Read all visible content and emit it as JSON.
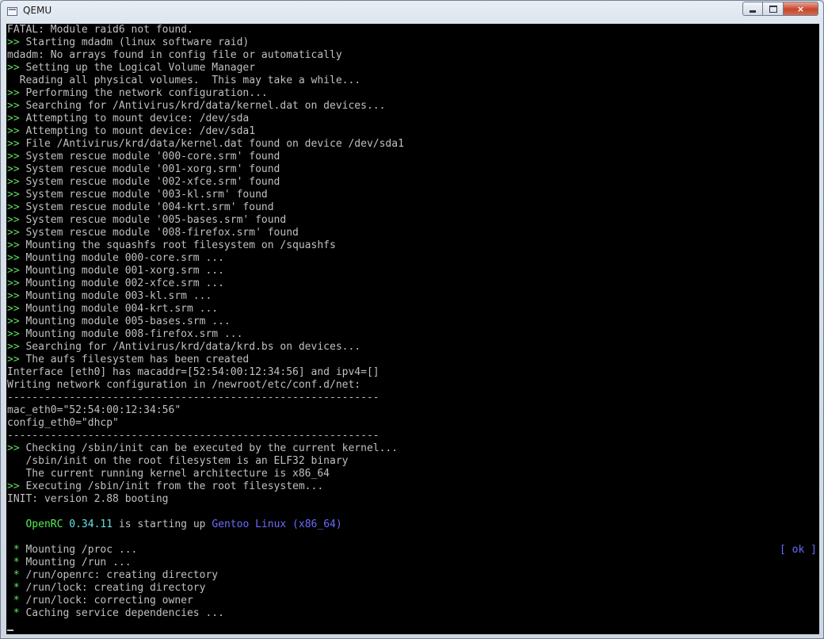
{
  "window": {
    "title": "QEMU",
    "icon": "qemu-window-icon",
    "minimize_icon": "minimize-icon",
    "maximize_icon": "maximize-icon",
    "close_icon": "close-icon",
    "close_label": "×"
  },
  "colors": {
    "terminal_bg": "#000000",
    "text": "#c0c0c0",
    "prompt_green": "#55ee55",
    "cyan": "#66e0e0",
    "blue": "#6b6bff"
  },
  "terminal": {
    "lines": [
      {
        "text": "FATAL: Module raid6 not found."
      },
      {
        "prefix": ">>",
        "text": " Starting mdadm (linux software raid)"
      },
      {
        "text": "mdadm: No arrays found in config file or automatically"
      },
      {
        "prefix": ">>",
        "text": " Setting up the Logical Volume Manager"
      },
      {
        "text": "  Reading all physical volumes.  This may take a while..."
      },
      {
        "prefix": ">>",
        "text": " Performing the network configuration..."
      },
      {
        "prefix": ">>",
        "text": " Searching for /Antivirus/krd/data/kernel.dat on devices..."
      },
      {
        "prefix": ">>",
        "text": " Attempting to mount device: /dev/sda"
      },
      {
        "prefix": ">>",
        "text": " Attempting to mount device: /dev/sda1"
      },
      {
        "prefix": ">>",
        "text": " File /Antivirus/krd/data/kernel.dat found on device /dev/sda1"
      },
      {
        "prefix": ">>",
        "text": " System rescue module '000-core.srm' found"
      },
      {
        "prefix": ">>",
        "text": " System rescue module '001-xorg.srm' found"
      },
      {
        "prefix": ">>",
        "text": " System rescue module '002-xfce.srm' found"
      },
      {
        "prefix": ">>",
        "text": " System rescue module '003-kl.srm' found"
      },
      {
        "prefix": ">>",
        "text": " System rescue module '004-krt.srm' found"
      },
      {
        "prefix": ">>",
        "text": " System rescue module '005-bases.srm' found"
      },
      {
        "prefix": ">>",
        "text": " System rescue module '008-firefox.srm' found"
      },
      {
        "prefix": ">>",
        "text": " Mounting the squashfs root filesystem on /squashfs"
      },
      {
        "prefix": ">>",
        "text": " Mounting module 000-core.srm ..."
      },
      {
        "prefix": ">>",
        "text": " Mounting module 001-xorg.srm ..."
      },
      {
        "prefix": ">>",
        "text": " Mounting module 002-xfce.srm ..."
      },
      {
        "prefix": ">>",
        "text": " Mounting module 003-kl.srm ..."
      },
      {
        "prefix": ">>",
        "text": " Mounting module 004-krt.srm ..."
      },
      {
        "prefix": ">>",
        "text": " Mounting module 005-bases.srm ..."
      },
      {
        "prefix": ">>",
        "text": " Mounting module 008-firefox.srm ..."
      },
      {
        "prefix": ">>",
        "text": " Searching for /Antivirus/krd/data/krd.bs on devices..."
      },
      {
        "prefix": ">>",
        "text": " The aufs filesystem has been created"
      },
      {
        "text": "Interface [eth0] has macaddr=[52:54:00:12:34:56] and ipv4=[]"
      },
      {
        "text": "Writing network configuration in /newroot/etc/conf.d/net:"
      },
      {
        "text": "------------------------------------------------------------"
      },
      {
        "text": "mac_eth0=\"52:54:00:12:34:56\""
      },
      {
        "text": "config_eth0=\"dhcp\""
      },
      {
        "text": "------------------------------------------------------------"
      },
      {
        "prefix": ">>",
        "text": " Checking /sbin/init can be executed by the current kernel..."
      },
      {
        "text": "   /sbin/init on the root filesystem is an ELF32 binary"
      },
      {
        "text": "   The current running kernel architecture is x86_64"
      },
      {
        "prefix": ">>",
        "text": " Executing /sbin/init from the root filesystem..."
      },
      {
        "text": "INIT: version 2.88 booting"
      },
      {
        "text": ""
      },
      {
        "openrc": {
          "pad": "   ",
          "name": "OpenRC",
          "version": "0.34.11",
          "middle": " is starting up ",
          "os": "Gentoo Linux (x86_64)"
        }
      },
      {
        "text": ""
      },
      {
        "bullet": " *",
        "text": " Mounting /proc ...",
        "ok": "[ ok ]"
      },
      {
        "bullet": " *",
        "text": " Mounting /run ..."
      },
      {
        "bullet": " *",
        "text": " /run/openrc: creating directory"
      },
      {
        "bullet": " *",
        "text": " /run/lock: creating directory"
      },
      {
        "bullet": " *",
        "text": " /run/lock: correcting owner"
      },
      {
        "bullet": " *",
        "text": " Caching service dependencies ..."
      }
    ]
  }
}
